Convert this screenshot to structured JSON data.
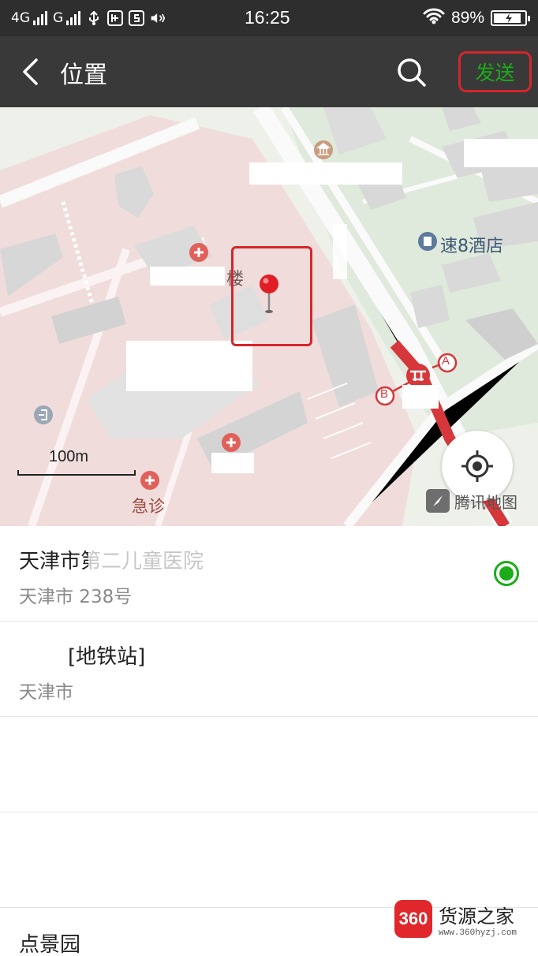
{
  "status_bar": {
    "network_1": "4G",
    "network_2": "G",
    "time": "16:25",
    "battery_percent": "89%",
    "battery_level": 0.89
  },
  "header": {
    "title": "位置",
    "send_label": "发送"
  },
  "map": {
    "labels": {
      "building_suffix": "楼",
      "hotel": "速8酒店",
      "emergency": "急诊",
      "exit_a": "A",
      "exit_b": "B"
    },
    "scale_label": "100m",
    "provider": "腾讯地图"
  },
  "locations": [
    {
      "title": "天津市第二儿童医院",
      "subtitle": "天津市           238号",
      "selected": true
    },
    {
      "title": "[地铁站]",
      "subtitle": "天津市",
      "selected": false
    },
    {
      "title": "",
      "subtitle": "",
      "selected": false
    },
    {
      "title": "",
      "subtitle": "",
      "selected": false
    },
    {
      "title": "点景园",
      "subtitle": "",
      "selected": false
    }
  ],
  "watermark": {
    "logo": "360",
    "name": "货源之家",
    "url": "www.360hyzj.com"
  },
  "colors": {
    "accent_green": "#1aad19",
    "highlight_red": "#d4262b"
  }
}
